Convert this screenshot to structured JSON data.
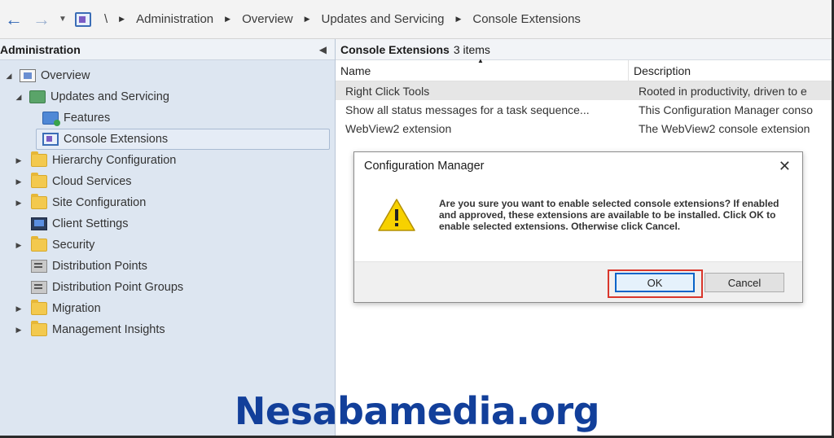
{
  "address_bar": {
    "root": "\\",
    "breadcrumbs": [
      "Administration",
      "Overview",
      "Updates and Servicing",
      "Console Extensions"
    ]
  },
  "left_pane": {
    "title": "Administration",
    "tree": [
      {
        "label": "Overview",
        "icon": "overview-icon"
      },
      {
        "label": "Updates and Servicing",
        "icon": "updates-icon"
      },
      {
        "label": "Features",
        "icon": "features-icon"
      },
      {
        "label": "Console Extensions",
        "icon": "console-extension-icon",
        "selected": true
      },
      {
        "label": "Hierarchy Configuration",
        "icon": "folder-icon"
      },
      {
        "label": "Cloud Services",
        "icon": "folder-icon"
      },
      {
        "label": "Site Configuration",
        "icon": "folder-icon"
      },
      {
        "label": "Client Settings",
        "icon": "client-settings-icon"
      },
      {
        "label": "Security",
        "icon": "folder-icon"
      },
      {
        "label": "Distribution Points",
        "icon": "distribution-point-icon"
      },
      {
        "label": "Distribution Point Groups",
        "icon": "distribution-point-group-icon"
      },
      {
        "label": "Migration",
        "icon": "folder-icon"
      },
      {
        "label": "Management Insights",
        "icon": "folder-icon"
      }
    ]
  },
  "right_pane": {
    "title": "Console Extensions",
    "count": "3 items",
    "columns": [
      "Name",
      "Description"
    ],
    "rows": [
      {
        "name": "Right Click Tools",
        "description": "Rooted in productivity, driven to e"
      },
      {
        "name": "Show all status messages for a task sequence...",
        "description": "This Configuration Manager conso"
      },
      {
        "name": "WebView2 extension",
        "description": "The WebView2 console extension"
      }
    ]
  },
  "dialog": {
    "title": "Configuration Manager",
    "message": "Are you sure you want to enable selected console extensions? If enabled and approved, these extensions are available to be installed. Click OK to enable selected extensions. Otherwise click Cancel.",
    "ok_label": "OK",
    "cancel_label": "Cancel"
  },
  "watermark": "Nesabamedia.org",
  "colors": {
    "left_pane_bg": "#dde6f1",
    "highlight": "#d9362b",
    "watermark": "#123f9a",
    "warning": "#f7d100"
  }
}
